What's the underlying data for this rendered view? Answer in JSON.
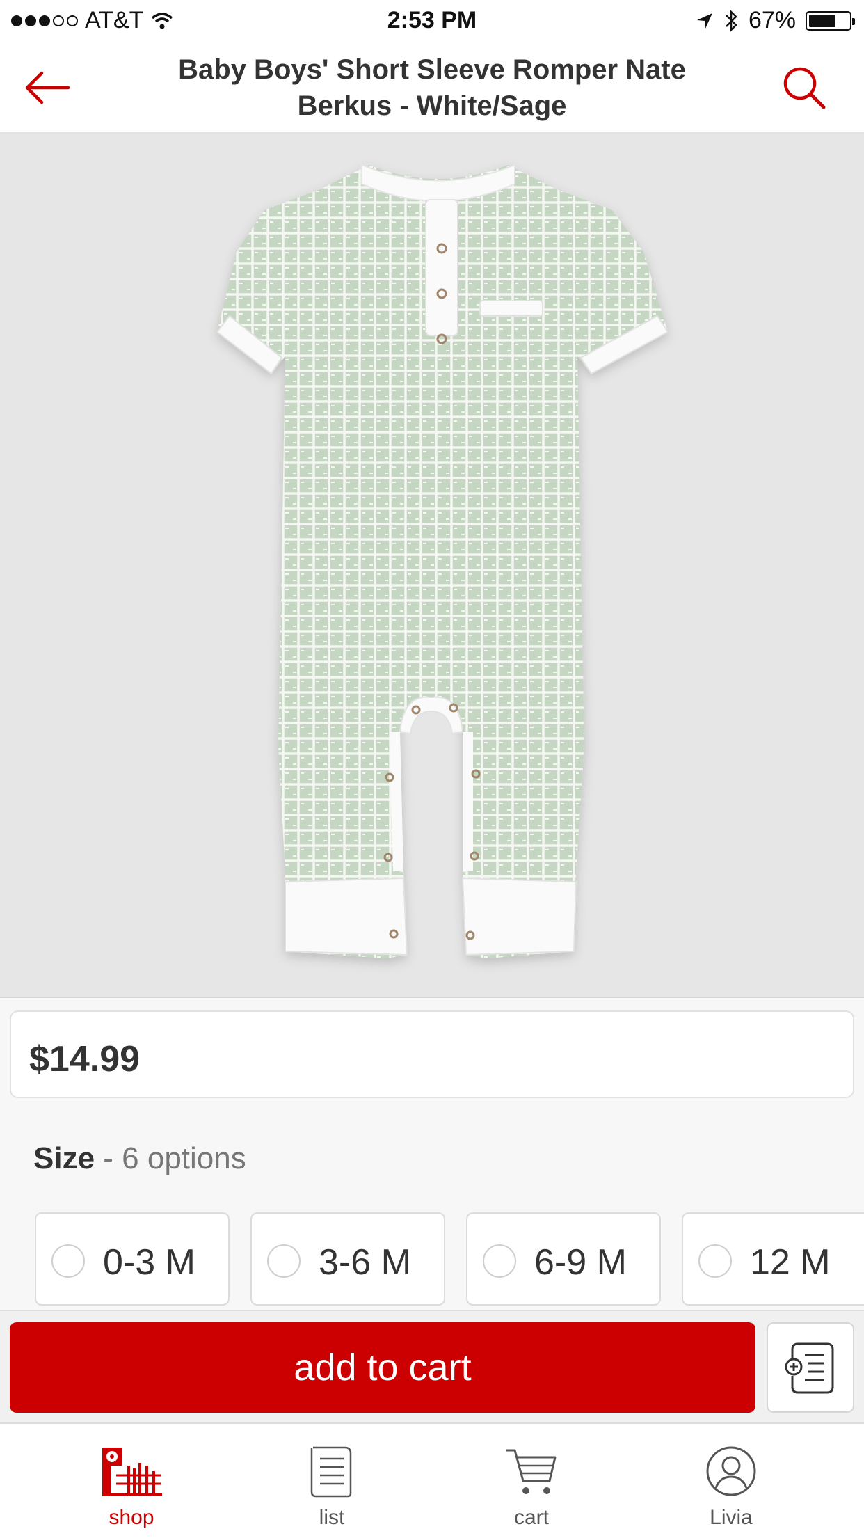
{
  "status_bar": {
    "carrier": "AT&T",
    "time": "2:53 PM",
    "battery": "67%",
    "battery_level": 0.67
  },
  "nav": {
    "title": "Baby Boys' Short Sleeve Romper Nate Berkus - White/Sage",
    "back_icon": "arrow-left-icon",
    "search_icon": "search-icon"
  },
  "product": {
    "image_alt": "romper-image",
    "price": "$14.99"
  },
  "size": {
    "label": "Size",
    "count": "- 6 options",
    "options": [
      "0-3 M",
      "3-6 M",
      "6-9 M",
      "12 M"
    ]
  },
  "actions": {
    "add_to_cart": "add to cart",
    "list_add_icon": "add-to-list-icon"
  },
  "tabs": [
    {
      "label": "shop",
      "icon": "store-icon",
      "active": true
    },
    {
      "label": "list",
      "icon": "list-icon",
      "active": false
    },
    {
      "label": "cart",
      "icon": "cart-icon",
      "active": false
    },
    {
      "label": "Livia",
      "icon": "profile-icon",
      "active": false
    }
  ],
  "colors": {
    "brand_red": "#cc0000",
    "romper_sage": "#c5d6c3"
  }
}
